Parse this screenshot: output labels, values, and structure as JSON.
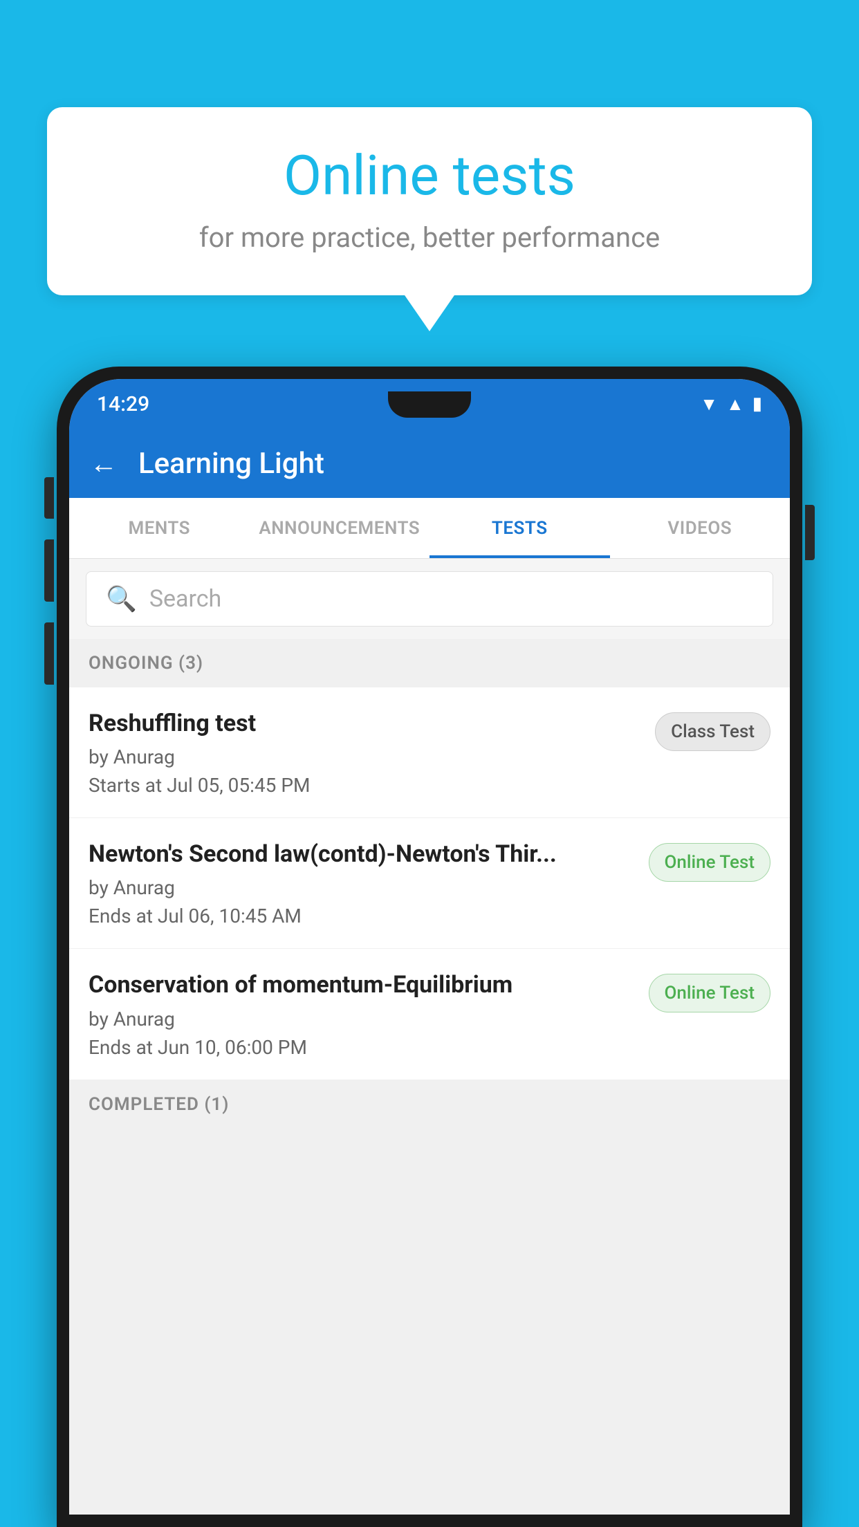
{
  "background_color": "#1ab8e8",
  "speech_bubble": {
    "title": "Online tests",
    "subtitle": "for more practice, better performance"
  },
  "status_bar": {
    "time": "14:29",
    "icons": [
      "wifi",
      "signal",
      "battery"
    ]
  },
  "app_bar": {
    "back_label": "←",
    "title": "Learning Light"
  },
  "tabs": [
    {
      "label": "MENTS",
      "active": false
    },
    {
      "label": "ANNOUNCEMENTS",
      "active": false
    },
    {
      "label": "TESTS",
      "active": true
    },
    {
      "label": "VIDEOS",
      "active": false
    }
  ],
  "search": {
    "placeholder": "Search"
  },
  "ongoing_section": {
    "label": "ONGOING (3)"
  },
  "tests": [
    {
      "title": "Reshuffling test",
      "by": "by Anurag",
      "date": "Starts at  Jul 05, 05:45 PM",
      "badge": "Class Test",
      "badge_type": "class"
    },
    {
      "title": "Newton's Second law(contd)-Newton's Thir...",
      "by": "by Anurag",
      "date": "Ends at  Jul 06, 10:45 AM",
      "badge": "Online Test",
      "badge_type": "online"
    },
    {
      "title": "Conservation of momentum-Equilibrium",
      "by": "by Anurag",
      "date": "Ends at  Jun 10, 06:00 PM",
      "badge": "Online Test",
      "badge_type": "online"
    }
  ],
  "completed_section": {
    "label": "COMPLETED (1)"
  }
}
